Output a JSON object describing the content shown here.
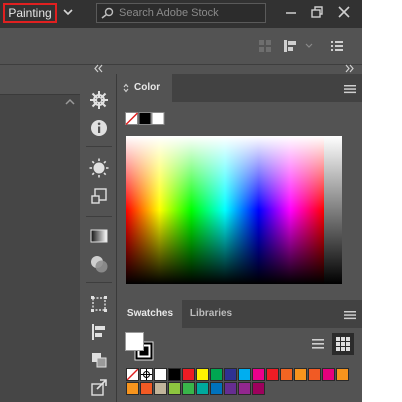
{
  "topbar": {
    "workspace": "Painting",
    "search_placeholder": "Search Adobe Stock"
  },
  "panels": {
    "color_tab": "Color",
    "swatches_tab": "Swatches",
    "libraries_tab": "Libraries"
  },
  "colors": {
    "chrome_dark": "#323232",
    "panel": "#535353",
    "highlight": "#e02020"
  },
  "icons": {
    "tool_panels": [
      "helm-icon",
      "info-icon",
      "brightness-icon",
      "transform-icon",
      "gradient-icon",
      "transparency-icon",
      "artboard-icon",
      "align-icon",
      "pathfinder-icon",
      "export-icon"
    ]
  },
  "swatches": {
    "row1": [
      "none",
      "registration",
      "#ffffff",
      "#000000",
      "#ed1c24",
      "#fff200",
      "#00a651",
      "#2e3192",
      "#00aeef",
      "#ec008c",
      "#ed1c24",
      "#f26522",
      "#f7941d",
      "#f15a24",
      "#e6007e",
      "#f7941d"
    ],
    "row2": [
      "#f7941d",
      "#f15a24",
      "#c2b59b",
      "#8dc63f",
      "#39b54a",
      "#00a99d",
      "#0072bc",
      "#662d91",
      "#92278f",
      "#9e005d"
    ]
  }
}
